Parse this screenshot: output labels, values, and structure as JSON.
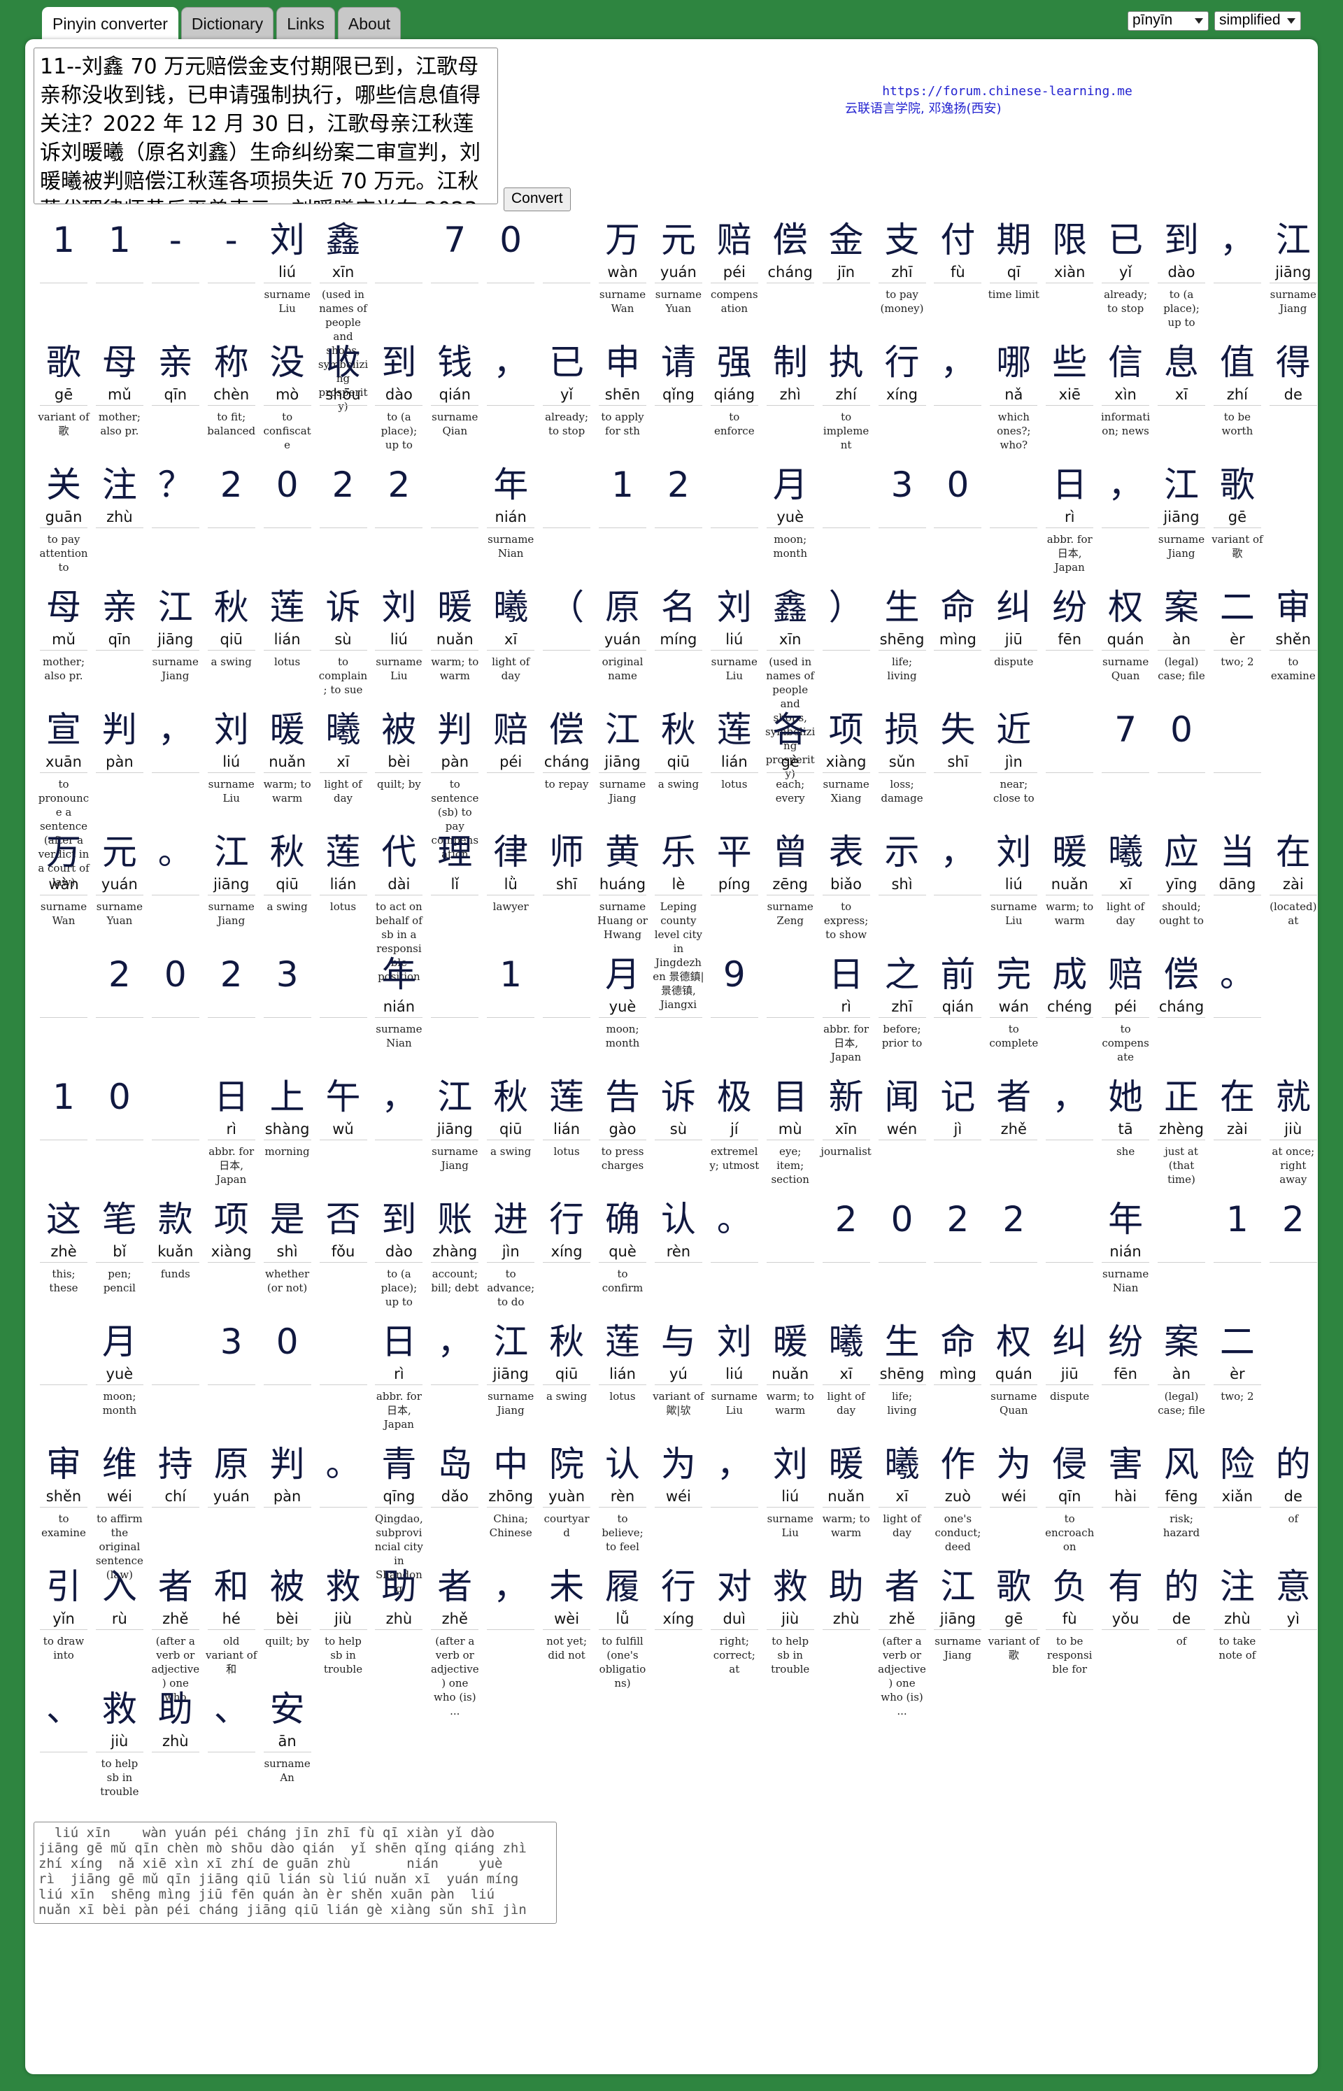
{
  "tabs": [
    "Pinyin converter",
    "Dictionary",
    "Links",
    "About"
  ],
  "selects": {
    "pinyin": "pīnyīn",
    "script": "simplified"
  },
  "input_text": "11--刘鑫 70 万元赔偿金支付期限已到，江歌母亲称没收到钱，已申请强制执行，哪些信息值得关注？2022 年 12 月 30 日，江歌母亲江秋莲诉刘暖曦（原名刘鑫）生命纠纷案二审宣判，刘暖曦被判赔偿江秋莲各项损失近 70 万元。江秋莲代理律师黄乐平曾表示，刘暖曦应当在 2023 年 1 月 9 日之前完成赔偿。",
  "convert_label": "Convert",
  "credits": {
    "url": "https://forum.chinese-learning.me",
    "org": "云联语言学院, 邓逸扬(西安)"
  },
  "rows": [
    [
      {
        "h": "1"
      },
      {
        "h": "1"
      },
      {
        "h": "-"
      },
      {
        "h": "-"
      },
      {
        "h": "刘",
        "p": "liú",
        "e": "surname Liu"
      },
      {
        "h": "鑫",
        "p": "xīn",
        "e": "(used in names of people and shops, symbolizing prosperity)"
      },
      {
        "h": ""
      },
      {
        "h": "7"
      },
      {
        "h": "0"
      },
      {
        "h": ""
      },
      {
        "h": "万",
        "p": "wàn",
        "e": "surname Wan"
      },
      {
        "h": "元",
        "p": "yuán",
        "e": "surname Yuan"
      },
      {
        "h": "赔",
        "p": "péi",
        "e": "compensation"
      },
      {
        "h": "偿",
        "p": "cháng"
      },
      {
        "h": "金",
        "p": "jīn"
      },
      {
        "h": "支",
        "p": "zhī",
        "e": "to pay (money)"
      },
      {
        "h": "付",
        "p": "fù"
      },
      {
        "h": "期",
        "p": "qī",
        "e": "time limit"
      },
      {
        "h": "限",
        "p": "xiàn"
      },
      {
        "h": "已",
        "p": "yǐ",
        "e": "already; to stop"
      },
      {
        "h": "到",
        "p": "dào",
        "e": "to (a place); up to"
      },
      {
        "h": "，"
      },
      {
        "h": "江",
        "p": "jiāng",
        "e": "surname Jiang"
      }
    ],
    [
      {
        "h": "歌",
        "p": "gē",
        "e": "variant of 歌"
      },
      {
        "h": "母",
        "p": "mǔ",
        "e": "mother; also pr."
      },
      {
        "h": "亲",
        "p": "qīn"
      },
      {
        "h": "称",
        "p": "chèn",
        "e": "to fit; balanced"
      },
      {
        "h": "没",
        "p": "mò",
        "e": "to confiscate"
      },
      {
        "h": "收",
        "p": "shōu"
      },
      {
        "h": "到",
        "p": "dào",
        "e": "to (a place); up to"
      },
      {
        "h": "钱",
        "p": "qián",
        "e": "surname Qian"
      },
      {
        "h": "，"
      },
      {
        "h": "已",
        "p": "yǐ",
        "e": "already; to stop"
      },
      {
        "h": "申",
        "p": "shēn",
        "e": "to apply for sth"
      },
      {
        "h": "请",
        "p": "qǐng"
      },
      {
        "h": "强",
        "p": "qiáng",
        "e": "to enforce"
      },
      {
        "h": "制",
        "p": "zhì"
      },
      {
        "h": "执",
        "p": "zhí",
        "e": "to implement"
      },
      {
        "h": "行",
        "p": "xíng"
      },
      {
        "h": "，"
      },
      {
        "h": "哪",
        "p": "nǎ",
        "e": "which ones?; who?"
      },
      {
        "h": "些",
        "p": "xiē"
      },
      {
        "h": "信",
        "p": "xìn",
        "e": "information; news"
      },
      {
        "h": "息",
        "p": "xī"
      },
      {
        "h": "值",
        "p": "zhí",
        "e": "to be worth"
      },
      {
        "h": "得",
        "p": "de"
      }
    ],
    [
      {
        "h": "关",
        "p": "guān",
        "e": "to pay attention to"
      },
      {
        "h": "注",
        "p": "zhù"
      },
      {
        "h": "？"
      },
      {
        "h": "2"
      },
      {
        "h": "0"
      },
      {
        "h": "2"
      },
      {
        "h": "2"
      },
      {
        "h": ""
      },
      {
        "h": "年",
        "p": "nián",
        "e": "surname Nian"
      },
      {
        "h": ""
      },
      {
        "h": "1"
      },
      {
        "h": "2"
      },
      {
        "h": ""
      },
      {
        "h": "月",
        "p": "yuè",
        "e": "moon; month"
      },
      {
        "h": ""
      },
      {
        "h": "3"
      },
      {
        "h": "0"
      },
      {
        "h": ""
      },
      {
        "h": "日",
        "p": "rì",
        "e": "abbr. for 日本, Japan"
      },
      {
        "h": "，"
      },
      {
        "h": "江",
        "p": "jiāng",
        "e": "surname Jiang"
      },
      {
        "h": "歌",
        "p": "gē",
        "e": "variant of 歌"
      }
    ],
    [
      {
        "h": "母",
        "p": "mǔ",
        "e": "mother; also pr."
      },
      {
        "h": "亲",
        "p": "qīn"
      },
      {
        "h": "江",
        "p": "jiāng",
        "e": "surname Jiang"
      },
      {
        "h": "秋",
        "p": "qiū",
        "e": "a swing"
      },
      {
        "h": "莲",
        "p": "lián",
        "e": "lotus"
      },
      {
        "h": "诉",
        "p": "sù",
        "e": "to complain; to sue"
      },
      {
        "h": "刘",
        "p": "liú",
        "e": "surname Liu"
      },
      {
        "h": "暖",
        "p": "nuǎn",
        "e": "warm; to warm"
      },
      {
        "h": "曦",
        "p": "xī",
        "e": "light of day"
      },
      {
        "h": "（"
      },
      {
        "h": "原",
        "p": "yuán",
        "e": "original name"
      },
      {
        "h": "名",
        "p": "míng"
      },
      {
        "h": "刘",
        "p": "liú",
        "e": "surname Liu"
      },
      {
        "h": "鑫",
        "p": "xīn",
        "e": "(used in names of people and shops, symbolizing prosperity)"
      },
      {
        "h": "）"
      },
      {
        "h": "生",
        "p": "shēng",
        "e": "life; living"
      },
      {
        "h": "命",
        "p": "mìng"
      },
      {
        "h": "纠",
        "p": "jiū",
        "e": "dispute"
      },
      {
        "h": "纷",
        "p": "fēn"
      },
      {
        "h": "权",
        "p": "quán",
        "e": "surname Quan"
      },
      {
        "h": "案",
        "p": "àn",
        "e": "(legal) case; file"
      },
      {
        "h": "二",
        "p": "èr",
        "e": "two; 2"
      },
      {
        "h": "审",
        "p": "shěn",
        "e": "to examine"
      }
    ],
    [
      {
        "h": "宣",
        "p": "xuān",
        "e": "to pronounce a sentence (after a verdict in a court of law)"
      },
      {
        "h": "判",
        "p": "pàn"
      },
      {
        "h": "，"
      },
      {
        "h": "刘",
        "p": "liú",
        "e": "surname Liu"
      },
      {
        "h": "暖",
        "p": "nuǎn",
        "e": "warm; to warm"
      },
      {
        "h": "曦",
        "p": "xī",
        "e": "light of day"
      },
      {
        "h": "被",
        "p": "bèi",
        "e": "quilt; by"
      },
      {
        "h": "判",
        "p": "pàn",
        "e": "to sentence (sb) to pay compensation"
      },
      {
        "h": "赔",
        "p": "péi"
      },
      {
        "h": "偿",
        "p": "cháng",
        "e": "to repay"
      },
      {
        "h": "江",
        "p": "jiāng",
        "e": "surname Jiang"
      },
      {
        "h": "秋",
        "p": "qiū",
        "e": "a swing"
      },
      {
        "h": "莲",
        "p": "lián",
        "e": "lotus"
      },
      {
        "h": "各",
        "p": "gè",
        "e": "each; every"
      },
      {
        "h": "项",
        "p": "xiàng",
        "e": "surname Xiang"
      },
      {
        "h": "损",
        "p": "sǔn",
        "e": "loss; damage"
      },
      {
        "h": "失",
        "p": "shī"
      },
      {
        "h": "近",
        "p": "jìn",
        "e": "near; close to"
      },
      {
        "h": ""
      },
      {
        "h": "7"
      },
      {
        "h": "0"
      },
      {
        "h": ""
      }
    ],
    [
      {
        "h": "万",
        "p": "wàn",
        "e": "surname Wan"
      },
      {
        "h": "元",
        "p": "yuán",
        "e": "surname Yuan"
      },
      {
        "h": "。"
      },
      {
        "h": "江",
        "p": "jiāng",
        "e": "surname Jiang"
      },
      {
        "h": "秋",
        "p": "qiū",
        "e": "a swing"
      },
      {
        "h": "莲",
        "p": "lián",
        "e": "lotus"
      },
      {
        "h": "代",
        "p": "dài",
        "e": "to act on behalf of sb in a responsible position"
      },
      {
        "h": "理",
        "p": "lǐ"
      },
      {
        "h": "律",
        "p": "lǜ",
        "e": "lawyer"
      },
      {
        "h": "师",
        "p": "shī"
      },
      {
        "h": "黄",
        "p": "huáng",
        "e": "surname Huang or Hwang"
      },
      {
        "h": "乐",
        "p": "lè",
        "e": "Leping county level city in Jingdezhen 景德鎮|景德镇, Jiangxi"
      },
      {
        "h": "平",
        "p": "píng"
      },
      {
        "h": "曾",
        "p": "zēng",
        "e": "surname Zeng"
      },
      {
        "h": "表",
        "p": "biǎo",
        "e": "to express; to show"
      },
      {
        "h": "示",
        "p": "shì"
      },
      {
        "h": "，"
      },
      {
        "h": "刘",
        "p": "liú",
        "e": "surname Liu"
      },
      {
        "h": "暖",
        "p": "nuǎn",
        "e": "warm; to warm"
      },
      {
        "h": "曦",
        "p": "xī",
        "e": "light of day"
      },
      {
        "h": "应",
        "p": "yīng",
        "e": "should; ought to"
      },
      {
        "h": "当",
        "p": "dāng"
      },
      {
        "h": "在",
        "p": "zài",
        "e": "(located) at"
      }
    ],
    [
      {
        "h": ""
      },
      {
        "h": "2"
      },
      {
        "h": "0"
      },
      {
        "h": "2"
      },
      {
        "h": "3"
      },
      {
        "h": ""
      },
      {
        "h": "年",
        "p": "nián",
        "e": "surname Nian"
      },
      {
        "h": ""
      },
      {
        "h": "1"
      },
      {
        "h": ""
      },
      {
        "h": "月",
        "p": "yuè",
        "e": "moon; month"
      },
      {
        "h": ""
      },
      {
        "h": "9"
      },
      {
        "h": ""
      },
      {
        "h": "日",
        "p": "rì",
        "e": "abbr. for 日本, Japan"
      },
      {
        "h": "之",
        "p": "zhī",
        "e": "before; prior to"
      },
      {
        "h": "前",
        "p": "qián"
      },
      {
        "h": "完",
        "p": "wán",
        "e": "to complete"
      },
      {
        "h": "成",
        "p": "chéng"
      },
      {
        "h": "赔",
        "p": "péi",
        "e": "to compensate"
      },
      {
        "h": "偿",
        "p": "cháng"
      },
      {
        "h": "。"
      }
    ],
    [
      {
        "h": "1"
      },
      {
        "h": "0"
      },
      {
        "h": ""
      },
      {
        "h": "日",
        "p": "rì",
        "e": "abbr. for 日本, Japan"
      },
      {
        "h": "上",
        "p": "shàng",
        "e": "morning"
      },
      {
        "h": "午",
        "p": "wǔ"
      },
      {
        "h": "，"
      },
      {
        "h": "江",
        "p": "jiāng",
        "e": "surname Jiang"
      },
      {
        "h": "秋",
        "p": "qiū",
        "e": "a swing"
      },
      {
        "h": "莲",
        "p": "lián",
        "e": "lotus"
      },
      {
        "h": "告",
        "p": "gào",
        "e": "to press charges"
      },
      {
        "h": "诉",
        "p": "sù"
      },
      {
        "h": "极",
        "p": "jí",
        "e": "extremely; utmost"
      },
      {
        "h": "目",
        "p": "mù",
        "e": "eye; item; section"
      },
      {
        "h": "新",
        "p": "xīn",
        "e": "journalist"
      },
      {
        "h": "闻",
        "p": "wén"
      },
      {
        "h": "记",
        "p": "jì"
      },
      {
        "h": "者",
        "p": "zhě"
      },
      {
        "h": "，"
      },
      {
        "h": "她",
        "p": "tā",
        "e": "she"
      },
      {
        "h": "正",
        "p": "zhèng",
        "e": "just at (that time)"
      },
      {
        "h": "在",
        "p": "zài"
      },
      {
        "h": "就",
        "p": "jiù",
        "e": "at once; right away"
      }
    ],
    [
      {
        "h": "这",
        "p": "zhè",
        "e": "this; these"
      },
      {
        "h": "笔",
        "p": "bǐ",
        "e": "pen; pencil"
      },
      {
        "h": "款",
        "p": "kuǎn",
        "e": "funds"
      },
      {
        "h": "项",
        "p": "xiàng"
      },
      {
        "h": "是",
        "p": "shì",
        "e": "whether (or not)"
      },
      {
        "h": "否",
        "p": "fǒu"
      },
      {
        "h": "到",
        "p": "dào",
        "e": "to (a place); up to"
      },
      {
        "h": "账",
        "p": "zhàng",
        "e": "account; bill; debt"
      },
      {
        "h": "进",
        "p": "jìn",
        "e": "to advance; to do"
      },
      {
        "h": "行",
        "p": "xíng"
      },
      {
        "h": "确",
        "p": "què",
        "e": "to confirm"
      },
      {
        "h": "认",
        "p": "rèn"
      },
      {
        "h": "。"
      },
      {
        "h": ""
      },
      {
        "h": "2"
      },
      {
        "h": "0"
      },
      {
        "h": "2"
      },
      {
        "h": "2"
      },
      {
        "h": ""
      },
      {
        "h": "年",
        "p": "nián",
        "e": "surname Nian"
      },
      {
        "h": ""
      },
      {
        "h": "1"
      },
      {
        "h": "2"
      }
    ],
    [
      {
        "h": ""
      },
      {
        "h": "月",
        "p": "yuè",
        "e": "moon; month"
      },
      {
        "h": ""
      },
      {
        "h": "3"
      },
      {
        "h": "0"
      },
      {
        "h": ""
      },
      {
        "h": "日",
        "p": "rì",
        "e": "abbr. for 日本, Japan"
      },
      {
        "h": "，"
      },
      {
        "h": "江",
        "p": "jiāng",
        "e": "surname Jiang"
      },
      {
        "h": "秋",
        "p": "qiū",
        "e": "a swing"
      },
      {
        "h": "莲",
        "p": "lián",
        "e": "lotus"
      },
      {
        "h": "与",
        "p": "yú",
        "e": "variant of 歟|欤"
      },
      {
        "h": "刘",
        "p": "liú",
        "e": "surname Liu"
      },
      {
        "h": "暖",
        "p": "nuǎn",
        "e": "warm; to warm"
      },
      {
        "h": "曦",
        "p": "xī",
        "e": "light of day"
      },
      {
        "h": "生",
        "p": "shēng",
        "e": "life; living"
      },
      {
        "h": "命",
        "p": "mìng"
      },
      {
        "h": "权",
        "p": "quán",
        "e": "surname Quan"
      },
      {
        "h": "纠",
        "p": "jiū",
        "e": "dispute"
      },
      {
        "h": "纷",
        "p": "fēn"
      },
      {
        "h": "案",
        "p": "àn",
        "e": "(legal) case; file"
      },
      {
        "h": "二",
        "p": "èr",
        "e": "two; 2"
      }
    ],
    [
      {
        "h": "审",
        "p": "shěn",
        "e": "to examine"
      },
      {
        "h": "维",
        "p": "wéi",
        "e": "to affirm the original sentence (law)"
      },
      {
        "h": "持",
        "p": "chí"
      },
      {
        "h": "原",
        "p": "yuán"
      },
      {
        "h": "判",
        "p": "pàn"
      },
      {
        "h": "。"
      },
      {
        "h": "青",
        "p": "qīng",
        "e": "Qingdao, subprovincial city in Shandong"
      },
      {
        "h": "岛",
        "p": "dǎo"
      },
      {
        "h": "中",
        "p": "zhōng",
        "e": "China; Chinese"
      },
      {
        "h": "院",
        "p": "yuàn",
        "e": "courtyard"
      },
      {
        "h": "认",
        "p": "rèn",
        "e": "to believe; to feel"
      },
      {
        "h": "为",
        "p": "wéi"
      },
      {
        "h": "，"
      },
      {
        "h": "刘",
        "p": "liú",
        "e": "surname Liu"
      },
      {
        "h": "暖",
        "p": "nuǎn",
        "e": "warm; to warm"
      },
      {
        "h": "曦",
        "p": "xī",
        "e": "light of day"
      },
      {
        "h": "作",
        "p": "zuò",
        "e": "one's conduct; deed"
      },
      {
        "h": "为",
        "p": "wéi"
      },
      {
        "h": "侵",
        "p": "qīn",
        "e": "to encroach on"
      },
      {
        "h": "害",
        "p": "hài"
      },
      {
        "h": "风",
        "p": "fēng",
        "e": "risk; hazard"
      },
      {
        "h": "险",
        "p": "xiǎn"
      },
      {
        "h": "的",
        "p": "de",
        "e": "of"
      }
    ],
    [
      {
        "h": "引",
        "p": "yǐn",
        "e": "to draw into"
      },
      {
        "h": "入",
        "p": "rù"
      },
      {
        "h": "者",
        "p": "zhě",
        "e": "(after a verb or adjective) one who"
      },
      {
        "h": "和",
        "p": "hé",
        "e": "old variant of 和"
      },
      {
        "h": "被",
        "p": "bèi",
        "e": "quilt; by"
      },
      {
        "h": "救",
        "p": "jiù",
        "e": "to help sb in trouble"
      },
      {
        "h": "助",
        "p": "zhù"
      },
      {
        "h": "者",
        "p": "zhě",
        "e": "(after a verb or adjective) one who (is) ..."
      },
      {
        "h": "，"
      },
      {
        "h": "未",
        "p": "wèi",
        "e": "not yet; did not"
      },
      {
        "h": "履",
        "p": "lǚ",
        "e": "to fulfill (one's obligations)"
      },
      {
        "h": "行",
        "p": "xíng"
      },
      {
        "h": "对",
        "p": "duì",
        "e": "right; correct; at"
      },
      {
        "h": "救",
        "p": "jiù",
        "e": "to help sb in trouble"
      },
      {
        "h": "助",
        "p": "zhù"
      },
      {
        "h": "者",
        "p": "zhě",
        "e": "(after a verb or adjective) one who (is) ..."
      },
      {
        "h": "江",
        "p": "jiāng",
        "e": "surname Jiang"
      },
      {
        "h": "歌",
        "p": "gē",
        "e": "variant of 歌"
      },
      {
        "h": "负",
        "p": "fù",
        "e": "to be responsible for"
      },
      {
        "h": "有",
        "p": "yǒu"
      },
      {
        "h": "的",
        "p": "de",
        "e": "of"
      },
      {
        "h": "注",
        "p": "zhù",
        "e": "to take note of"
      },
      {
        "h": "意",
        "p": "yì"
      }
    ],
    [
      {
        "h": "、"
      },
      {
        "h": "救",
        "p": "jiù",
        "e": "to help sb in trouble"
      },
      {
        "h": "助",
        "p": "zhù"
      },
      {
        "h": "、"
      },
      {
        "h": "安",
        "p": "ān",
        "e": "surname An"
      }
    ]
  ],
  "pinyin_output": "  liú xīn    wàn yuán péi cháng jīn zhī fù qī xiàn yǐ dào\njiāng gē mǔ qīn chèn mò shōu dào qián  yǐ shēn qǐng qiáng zhì\nzhí xíng  nǎ xiē xìn xī zhí de guān zhù       nián     yuè\nrì  jiāng gē mǔ qīn jiāng qiū lián sù liú nuǎn xī  yuán míng\nliú xīn  shēng mìng jiū fēn quán àn èr shěn xuān pàn  liú\nnuǎn xī bèi pàn péi cháng jiāng qiū lián gè xiàng sǔn shī jìn"
}
